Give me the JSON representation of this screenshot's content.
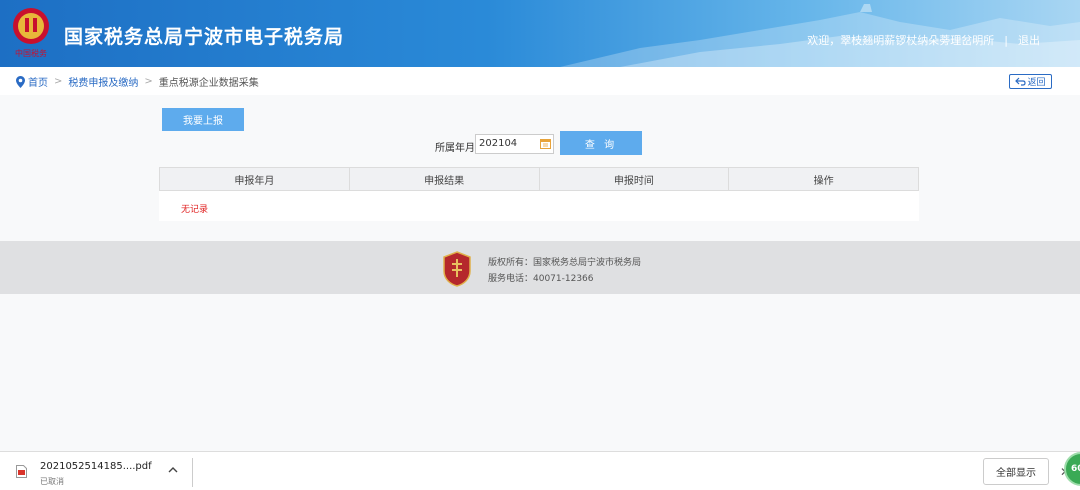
{
  "header": {
    "title": "国家税务总局宁波市电子税务局",
    "welcome": "欢迎，翠枝翘明薪锣杖纳朵蒡理岔明所",
    "separator": "|",
    "logout": "退出"
  },
  "breadcrumb": {
    "home": "首页",
    "level2": "税费申报及缴纳",
    "current": "重点税源企业数据采集",
    "arrow": ">",
    "back": "返回"
  },
  "main": {
    "report_button": "我要上报",
    "period_label": "所属年月:",
    "period_value": "202104",
    "query_button": "查 询",
    "table": {
      "headers": [
        "申报年月",
        "申报结果",
        "申报时间",
        "操作"
      ],
      "empty_text": "无记录"
    }
  },
  "footer": {
    "copyright": "版权所有：国家税务总局宁波市税务局",
    "phone": "服务电话：40071-12366"
  },
  "download_bar": {
    "filename": "2021052514185....pdf",
    "status": "已取消",
    "show_all": "全部显示",
    "close": "✕",
    "badge": "60"
  },
  "colors": {
    "accent": "#5eabed",
    "link": "#2a6bc4",
    "error": "#e02020"
  }
}
